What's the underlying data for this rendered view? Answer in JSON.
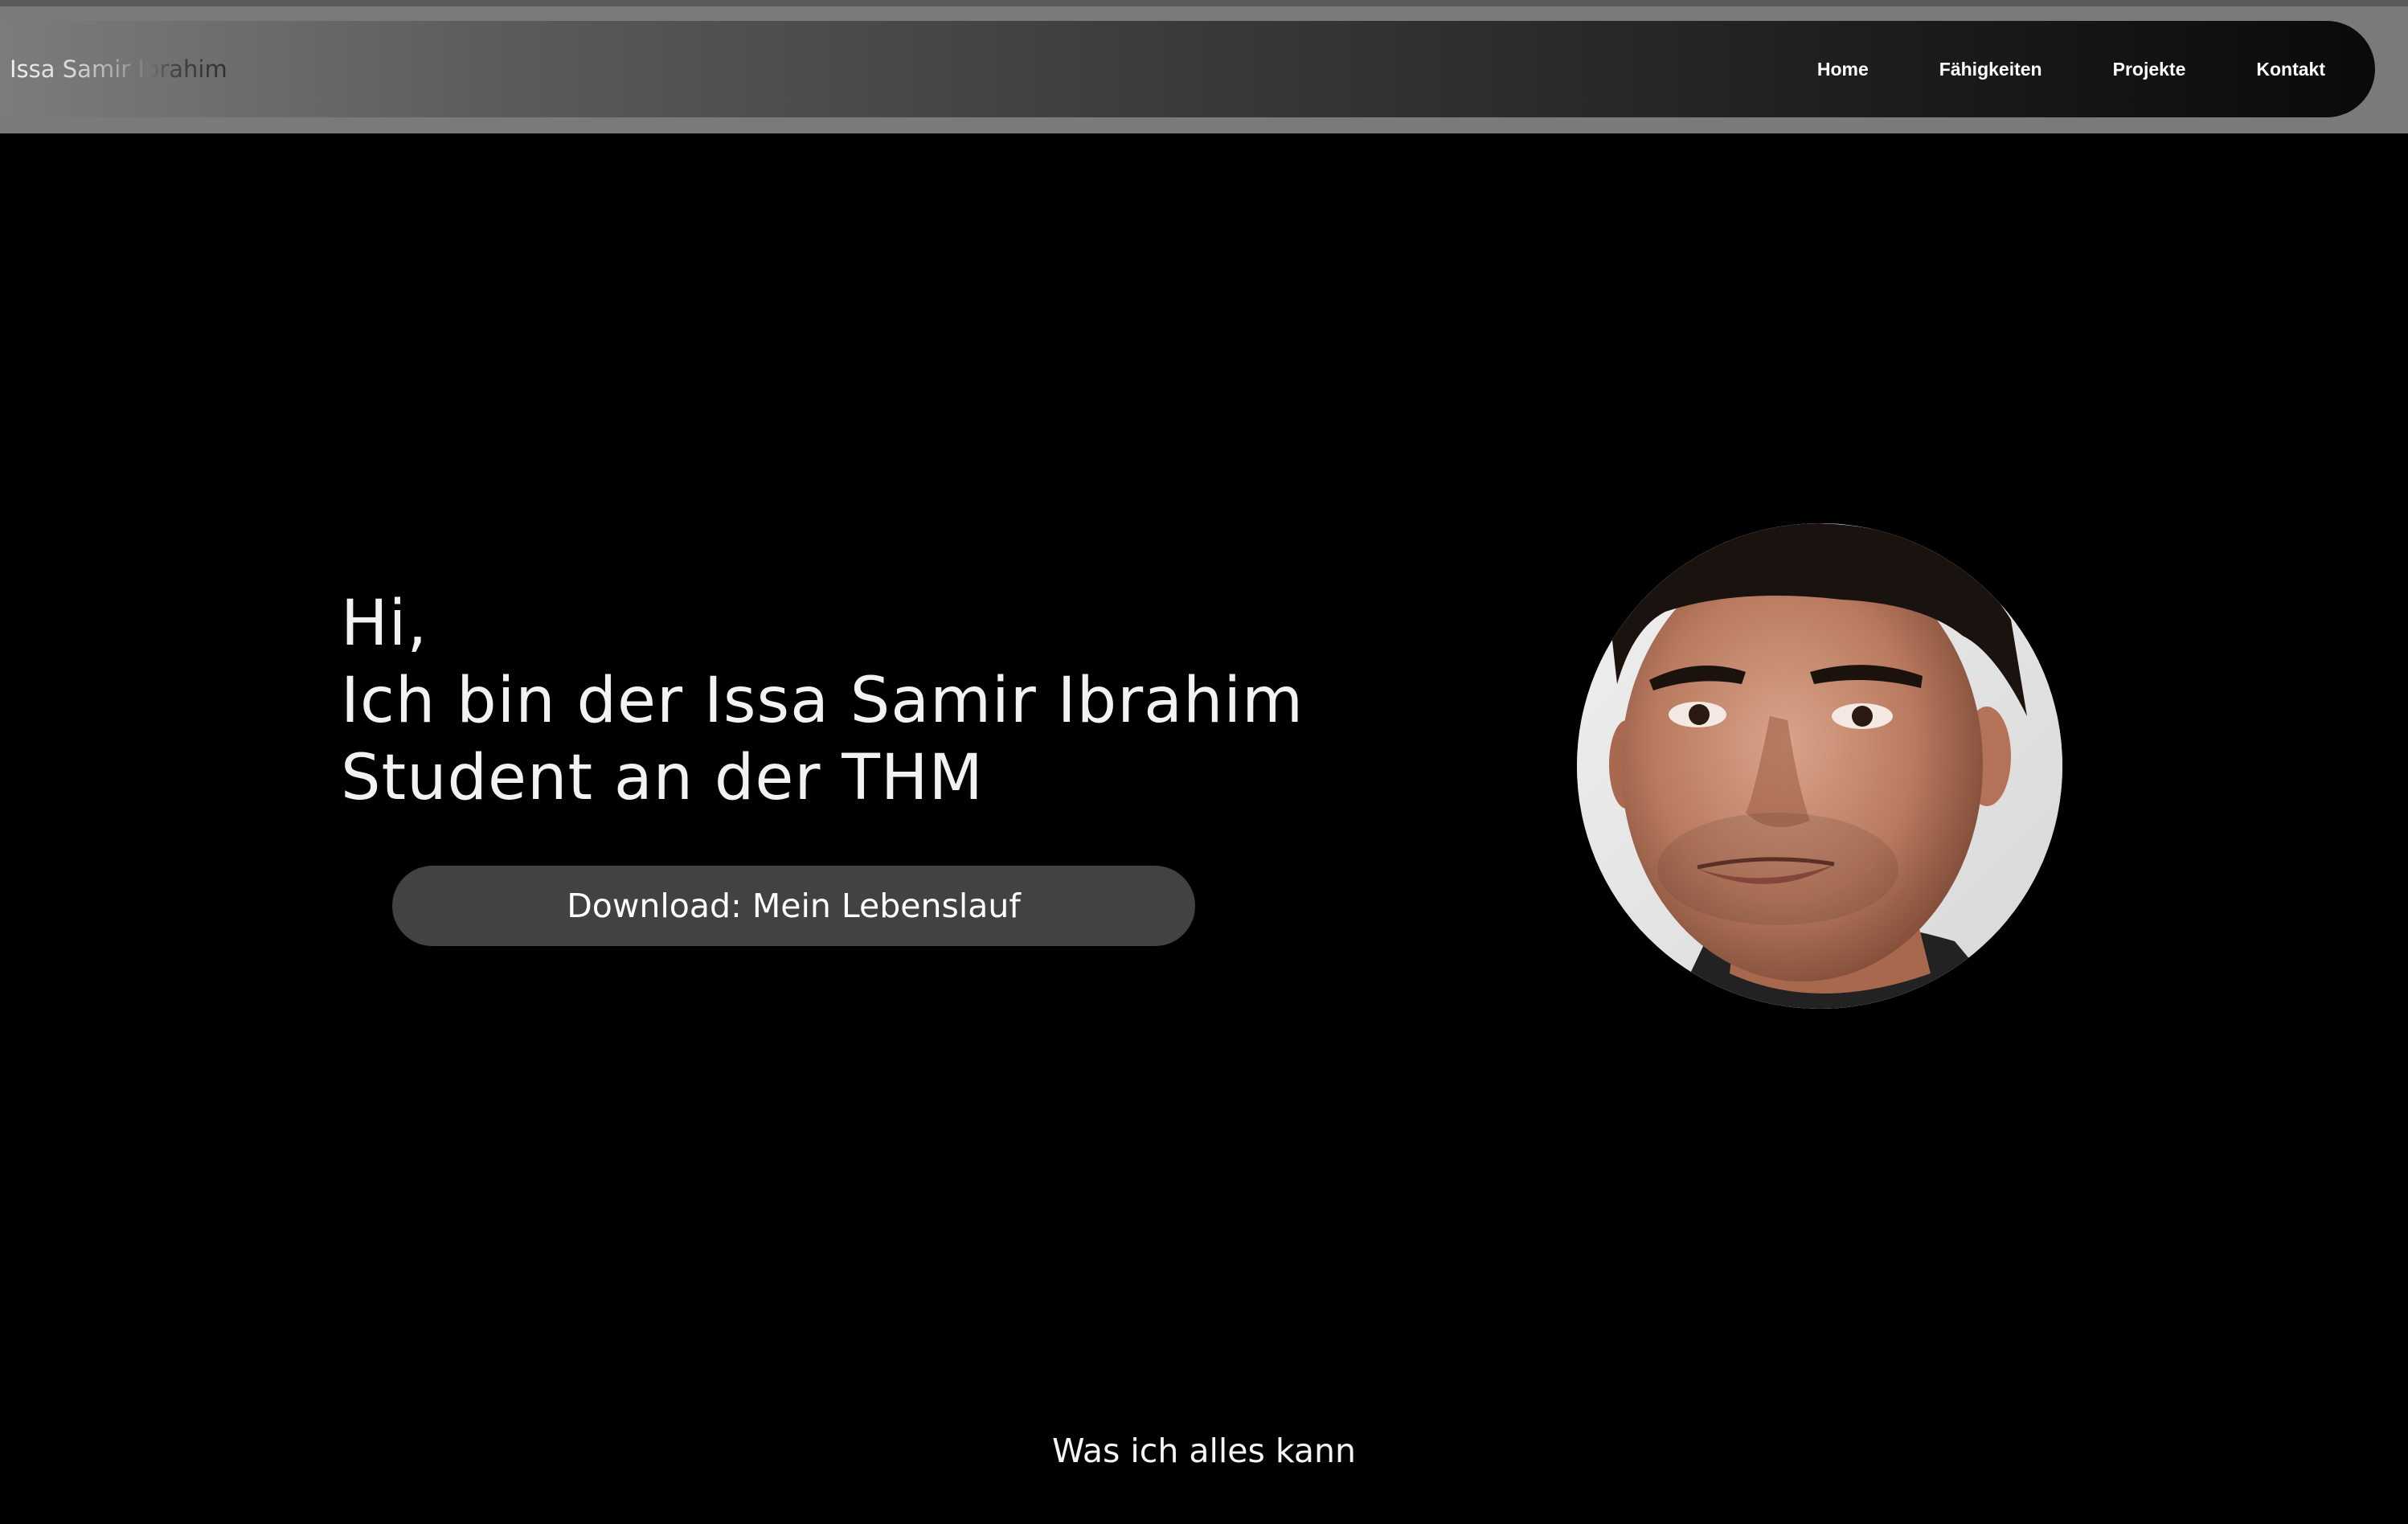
{
  "header": {
    "brand": "Issa Samir Ibrahim",
    "nav": [
      {
        "label": "Home"
      },
      {
        "label": "Fähigkeiten"
      },
      {
        "label": "Projekte"
      },
      {
        "label": "Kontakt"
      }
    ]
  },
  "hero": {
    "greeting": "Hi,",
    "intro": "Ich bin der Issa Samir Ibrahim",
    "role": "Student an der THM",
    "cv_button": "Download: Mein Lebenslauf",
    "portrait_icon": "profile-photo"
  },
  "skills": {
    "heading": "Was ich alles kann"
  },
  "colors": {
    "background": "#000000",
    "header_band": "#7a7a7a",
    "button_bg": "#424242",
    "text": "#f2f2f2"
  }
}
